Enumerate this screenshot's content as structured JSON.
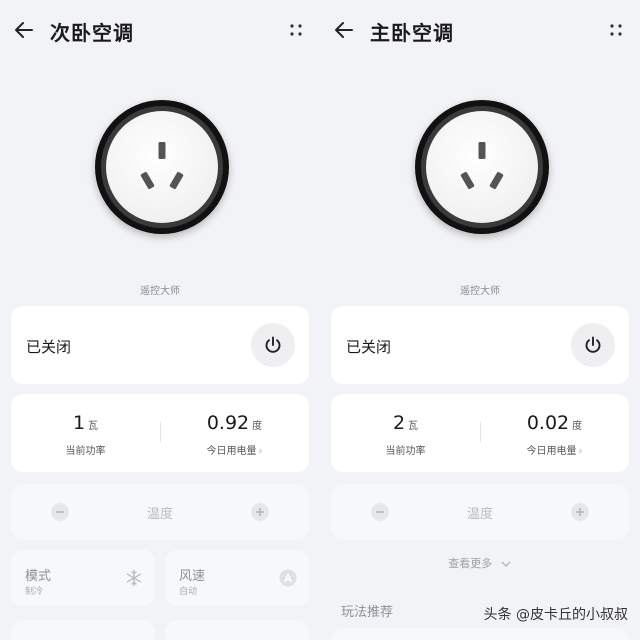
{
  "panels": {
    "left": {
      "title": "次卧空调",
      "source": "遥控大师",
      "status": "已关闭",
      "power": {
        "value": "1",
        "unit": "瓦",
        "label": "当前功率"
      },
      "energy": {
        "value": "0.92",
        "unit": "度",
        "label": "今日用电量"
      },
      "temperature_label": "温度",
      "tiles": [
        {
          "name": "模式",
          "sub": "制冷",
          "icon": "snowflake-icon"
        },
        {
          "name": "风速",
          "sub": "自动",
          "icon": "auto-a-icon"
        }
      ]
    },
    "right": {
      "title": "主卧空调",
      "source": "遥控大师",
      "status": "已关闭",
      "power": {
        "value": "2",
        "unit": "瓦",
        "label": "当前功率"
      },
      "energy": {
        "value": "0.02",
        "unit": "度",
        "label": "今日用电量"
      },
      "temperature_label": "温度",
      "see_more": "查看更多",
      "section_title": "玩法推荐"
    }
  },
  "watermark": "头条 @皮卡丘的小叔叔",
  "colors": {
    "background": "#f2f3f6",
    "card": "#ffffff",
    "disabled_card": "#f7f8fa",
    "plug_ring": "#111111"
  }
}
